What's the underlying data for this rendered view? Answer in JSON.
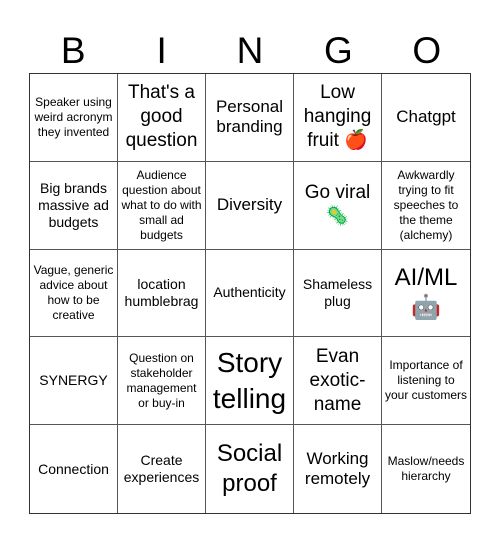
{
  "title_letters": [
    "B",
    "I",
    "N",
    "G",
    "O"
  ],
  "cells": [
    "Speaker using weird acronym they invented",
    "That's a good question",
    "Personal branding",
    "Low hanging fruit 🍎",
    "Chatgpt",
    "Big brands massive ad budgets",
    "Audience question about what to do with small ad budgets",
    "Diversity",
    "Go viral 🦠",
    "Awkwardly trying to fit speeches to the theme (alchemy)",
    "Vague, generic advice about how to be creative",
    "location humblebrag",
    "Authenticity",
    "Shameless plug",
    "AI/ML 🤖",
    "SYNERGY",
    "Question on stakeholder management or buy-in",
    "Story telling",
    "Evan exotic-name",
    "Importance of listening to your customers",
    "Connection",
    "Create experiences",
    "Social proof",
    "Working remotely",
    "Maslow/needs hierarchy"
  ]
}
